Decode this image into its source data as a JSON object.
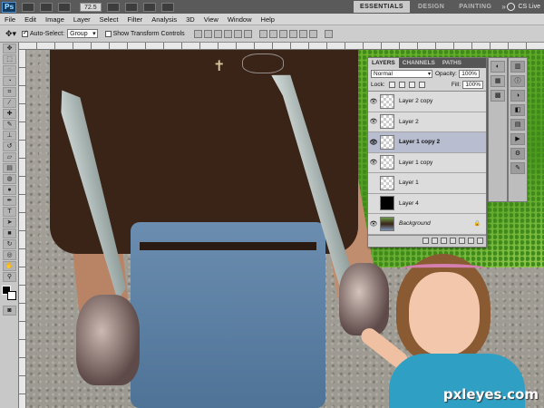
{
  "appbar": {
    "zoom": "72.5",
    "workspaces": [
      "ESSENTIALS",
      "DESIGN",
      "PAINTING"
    ],
    "more": "»",
    "cs_live": "CS Live"
  },
  "menu": [
    "File",
    "Edit",
    "Image",
    "Layer",
    "Select",
    "Filter",
    "Analysis",
    "3D",
    "View",
    "Window",
    "Help"
  ],
  "options": {
    "auto_select_label": "Auto-Select:",
    "auto_select_value": "Group",
    "transform_label": "Show Transform Controls"
  },
  "canvas": {
    "watermark": "pxleyes.com"
  },
  "layers_panel": {
    "tabs": [
      "LAYERS",
      "CHANNELS",
      "PATHS"
    ],
    "blend_mode": "Normal",
    "opacity_label": "Opacity:",
    "opacity": "100%",
    "lock_label": "Lock:",
    "fill_label": "Fill:",
    "fill": "100%",
    "layers": [
      {
        "name": "Layer 2 copy",
        "visible": true,
        "thumb": "transparent"
      },
      {
        "name": "Layer 2",
        "visible": true,
        "thumb": "transparent"
      },
      {
        "name": "Layer 1 copy 2",
        "visible": true,
        "thumb": "transparent",
        "selected": true
      },
      {
        "name": "Layer 1 copy",
        "visible": true,
        "thumb": "transparent"
      },
      {
        "name": "Layer 1",
        "visible": false,
        "thumb": "transparent"
      },
      {
        "name": "Layer 4",
        "visible": false,
        "thumb": "black"
      },
      {
        "name": "Background",
        "visible": true,
        "thumb": "photo",
        "locked": true
      }
    ]
  },
  "icons": {
    "eye": "eye-icon",
    "lock": "lock-icon"
  }
}
